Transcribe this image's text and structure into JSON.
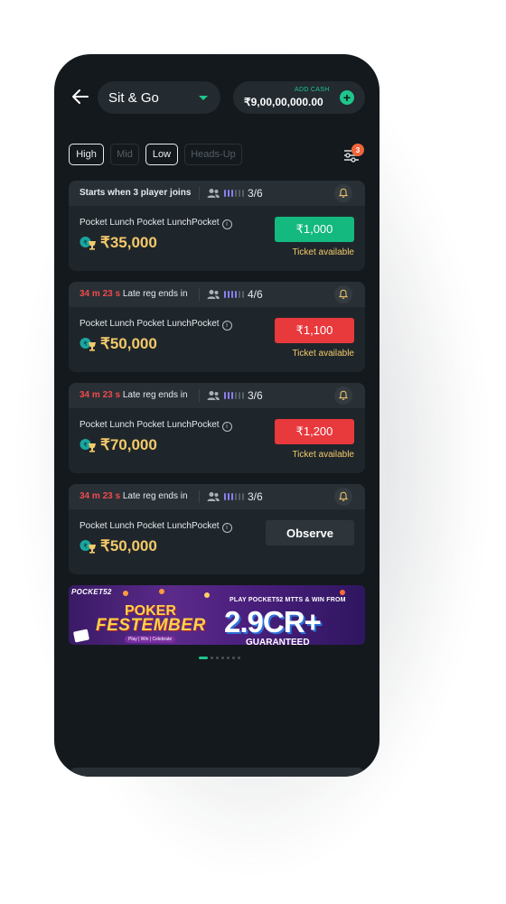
{
  "header": {
    "mode_label": "Sit & Go",
    "wallet_add_label": "ADD CASH",
    "wallet_balance": "₹9,00,00,000.00"
  },
  "filters": {
    "chips": [
      {
        "label": "High",
        "active": true
      },
      {
        "label": "Mid",
        "active": false
      },
      {
        "label": "Low",
        "active": true
      },
      {
        "label": "Heads-Up",
        "active": false
      }
    ],
    "badge_count": "3"
  },
  "tables": [
    {
      "timer": "",
      "status_text": "Starts when 3 player joins",
      "players": "3/6",
      "filled": 0.5,
      "name": "Pocket Lunch Pocket LunchPocket",
      "prize": "₹35,000",
      "action_label": "₹1,000",
      "action_type": "join",
      "action_color": "#13b97e",
      "ticket": "Ticket available"
    },
    {
      "timer": "34 m 23 s",
      "status_text": "Late reg ends in",
      "players": "4/6",
      "filled": 0.67,
      "name": "Pocket Lunch Pocket LunchPocket",
      "prize": "₹50,000",
      "action_label": "₹1,100",
      "action_type": "join",
      "action_color": "#e8393d",
      "ticket": "Ticket available"
    },
    {
      "timer": "34 m 23 s",
      "status_text": "Late reg ends in",
      "players": "3/6",
      "filled": 0.5,
      "name": "Pocket Lunch Pocket LunchPocket",
      "prize": "₹70,000",
      "action_label": "₹1,200",
      "action_type": "join",
      "action_color": "#e8393d",
      "ticket": "Ticket available"
    },
    {
      "timer": "34 m 23 s",
      "status_text": "Late reg ends in",
      "players": "3/6",
      "filled": 0.5,
      "name": "Pocket Lunch Pocket LunchPocket",
      "prize": "₹50,000",
      "action_label": "Observe",
      "action_type": "observe",
      "action_color": "#2d353b",
      "ticket": ""
    }
  ],
  "banner": {
    "brand": "POCKET52",
    "title_line1": "POKER",
    "title_line2": "FESTEMBER",
    "tagline": "Play | Win | Celebrate",
    "offer": "PLAY POCKET52 MTTS & WIN FROM",
    "amount": "2.9CR+",
    "guarantee": "GUARANTEED",
    "pages": 7,
    "current_page": 0
  },
  "colors": {
    "background": "#14191d",
    "accent": "#1fc58c",
    "prize": "#f3c96a",
    "timer": "#f24a4a",
    "bar_filled": "#8d7ff0",
    "bar_empty": "#565e66"
  }
}
